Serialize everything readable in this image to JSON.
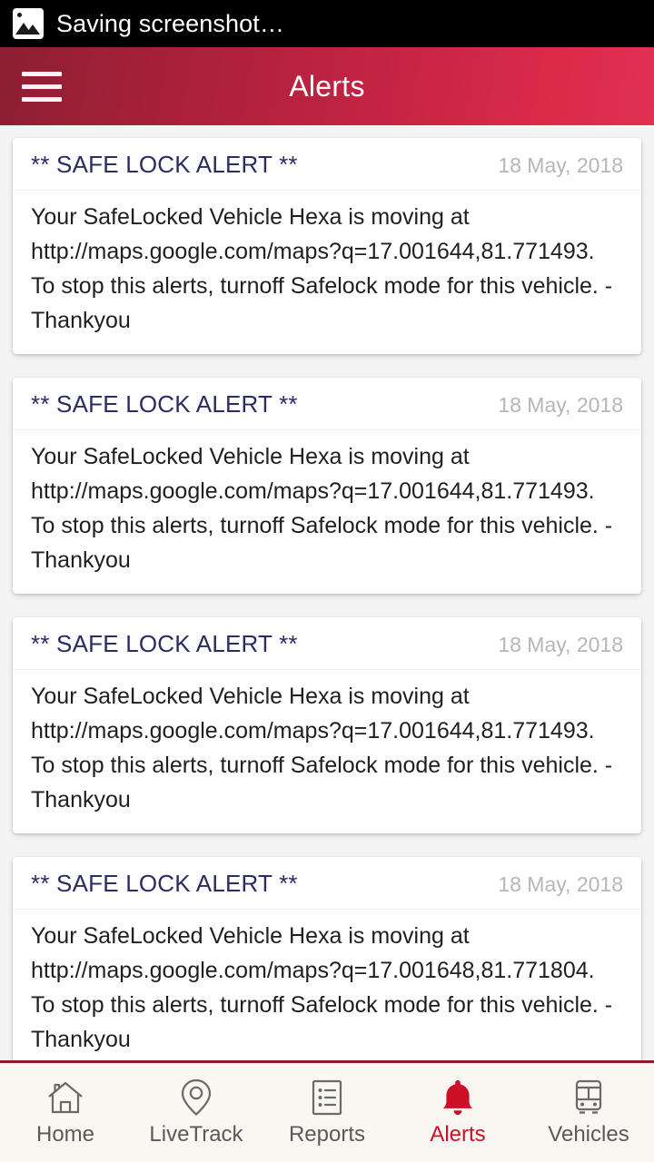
{
  "status_bar": {
    "icon": "image-screenshot-icon",
    "text": "Saving screenshot…"
  },
  "app_bar": {
    "menu_icon": "hamburger-menu-icon",
    "title": "Alerts",
    "gradient_start": "#8d1f33",
    "gradient_end": "#e03152"
  },
  "alerts": [
    {
      "title": "** SAFE LOCK ALERT **",
      "date": "18 May, 2018",
      "body": "Your SafeLocked Vehicle Hexa is moving at http://maps.google.com/maps?q=17.001644,81.771493. To stop this alerts, turnoff Safelock mode for this vehicle. -Thankyou"
    },
    {
      "title": "** SAFE LOCK ALERT **",
      "date": "18 May, 2018",
      "body": "Your SafeLocked Vehicle Hexa is moving at http://maps.google.com/maps?q=17.001644,81.771493. To stop this alerts, turnoff Safelock mode for this vehicle. -Thankyou"
    },
    {
      "title": "** SAFE LOCK ALERT **",
      "date": "18 May, 2018",
      "body": "Your SafeLocked Vehicle Hexa is moving at http://maps.google.com/maps?q=17.001644,81.771493. To stop this alerts, turnoff Safelock mode for this vehicle. -Thankyou"
    },
    {
      "title": "** SAFE LOCK ALERT **",
      "date": "18 May, 2018",
      "body": "Your SafeLocked Vehicle Hexa is moving at http://maps.google.com/maps?q=17.001648,81.771804. To stop this alerts, turnoff Safelock mode for this vehicle. -Thankyou"
    }
  ],
  "bottom_nav": {
    "active_color": "#cc1126",
    "inactive_color": "#5a5a5a",
    "items": [
      {
        "label": "Home",
        "icon": "home-icon",
        "active": false
      },
      {
        "label": "LiveTrack",
        "icon": "map-pin-icon",
        "active": false
      },
      {
        "label": "Reports",
        "icon": "list-icon",
        "active": false
      },
      {
        "label": "Alerts",
        "icon": "bell-icon",
        "active": true
      },
      {
        "label": "Vehicles",
        "icon": "bus-icon",
        "active": false
      }
    ]
  }
}
